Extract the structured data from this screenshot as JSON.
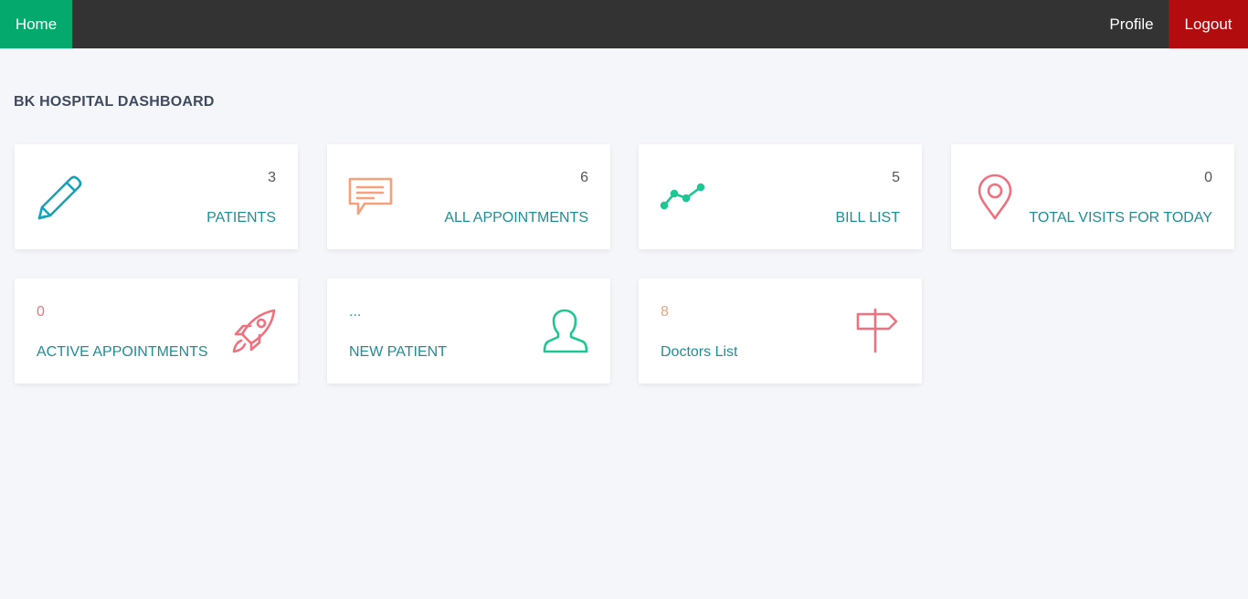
{
  "nav": {
    "home": "Home",
    "profile": "Profile",
    "logout": "Logout"
  },
  "page_title": "BK HOSPITAL DASHBOARD",
  "cards": [
    {
      "label": "PATIENTS",
      "count": "3",
      "icon": "pencil-icon",
      "icon_color": "#17a2b8"
    },
    {
      "label": "ALL APPOINTMENTS",
      "count": "6",
      "icon": "chat-icon",
      "icon_color": "#f7a07a"
    },
    {
      "label": "BILL LIST",
      "count": "5",
      "icon": "chart-line-icon",
      "icon_color": "#1dc793"
    },
    {
      "label": "TOTAL VISITS FOR TODAY",
      "count": "0",
      "icon": "map-pin-icon",
      "icon_color": "#f1707e"
    },
    {
      "label": "ACTIVE APPOINTMENTS",
      "count": "0",
      "icon": "rocket-icon",
      "icon_color": "#f1707e",
      "count_color": "#f1707e"
    },
    {
      "label": "NEW PATIENT",
      "count": "...",
      "icon": "user-icon",
      "icon_color": "#1dc793",
      "count_color": "#17a2b8"
    },
    {
      "label": "Doctors List",
      "count": "8",
      "icon": "signpost-icon",
      "icon_color": "#f1707e",
      "count_color": "#f7a07a"
    }
  ],
  "colors": {
    "nav_bg": "#333333",
    "home_bg": "#04aa6d",
    "logout_bg": "#b20c0f",
    "label": "#1f8e94",
    "page_bg": "#f5f6fa"
  }
}
